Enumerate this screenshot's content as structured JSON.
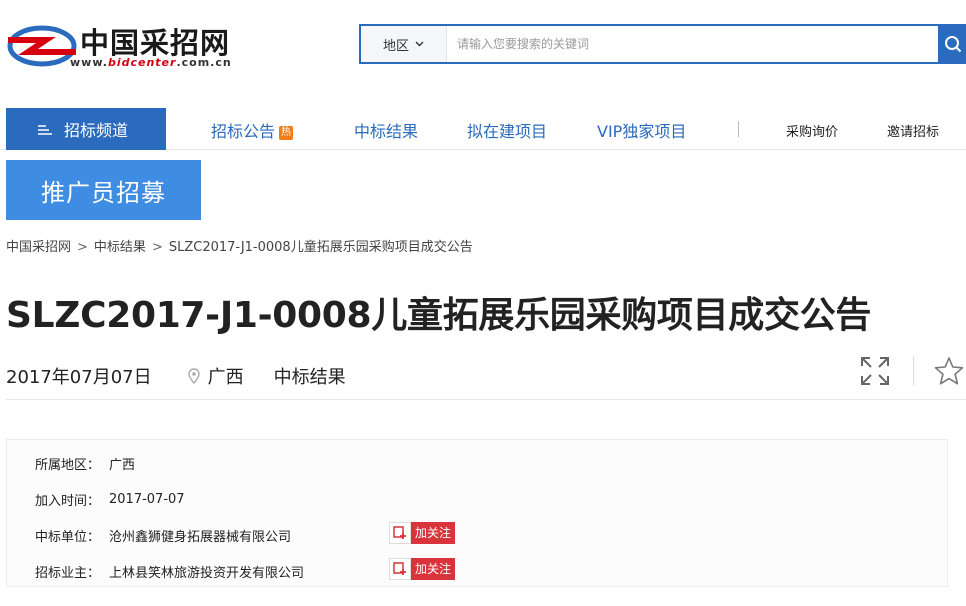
{
  "brand": {
    "name": "中国采招网",
    "url_prefix": "www.",
    "url_highlight": "bidcenter",
    "url_suffix": ".com.cn"
  },
  "search": {
    "region_label": "地区",
    "placeholder": "请输入您要搜索的关键词"
  },
  "nav": {
    "channel_label": "招标频道",
    "links": [
      "招标公告",
      "中标结果",
      "拟在建项目",
      "VIP独家项目"
    ],
    "hot_badge": "热",
    "right_links": [
      "采购询价",
      "邀请招标"
    ]
  },
  "banner": {
    "label": "推广员招募"
  },
  "breadcrumb": [
    "中国采招网",
    "中标结果",
    "SLZC2017-J1-0008儿童拓展乐园采购项目成交公告"
  ],
  "article": {
    "title": "SLZC2017-J1-0008儿童拓展乐园采购项目成交公告",
    "date": "2017年07月07日",
    "region": "广西",
    "type": "中标结果"
  },
  "info": {
    "region_label": "所属地区：",
    "region_value": "广西",
    "time_label": "加入时间：",
    "time_value": "2017-07-07",
    "winner_label": "中标单位：",
    "winner_value": "沧州鑫狮健身拓展器械有限公司",
    "owner_label": "招标业主：",
    "owner_value": "上林县笑林旅游投资开发有限公司",
    "follow_label": "加关注"
  },
  "colors": {
    "brand_blue": "#2b6bbd",
    "banner_blue": "#3f8de2",
    "follow_red": "#d9343b",
    "hot_orange": "#f07c1a"
  }
}
